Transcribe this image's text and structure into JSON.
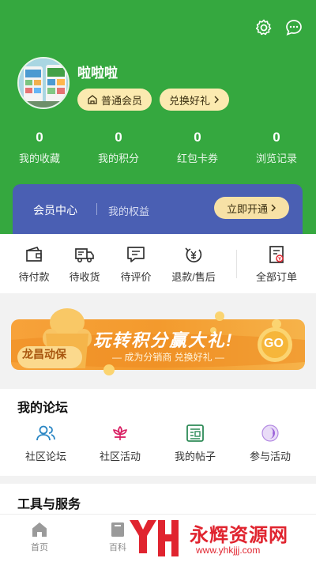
{
  "header": {
    "username": "啦啦啦",
    "member_badge": "普通会员",
    "redeem_label": "兑换好礼",
    "settings_icon": "gear-icon",
    "message_icon": "chat-bubble-icon"
  },
  "stats": [
    {
      "value": "0",
      "label": "我的收藏"
    },
    {
      "value": "0",
      "label": "我的积分"
    },
    {
      "value": "0",
      "label": "红包卡券"
    },
    {
      "value": "0",
      "label": "浏览记录"
    }
  ],
  "member_card": {
    "title": "会员中心",
    "subtitle": "我的权益",
    "button": "立即开通"
  },
  "orders": [
    {
      "label": "待付款",
      "icon": "wallet-icon"
    },
    {
      "label": "待收货",
      "icon": "truck-icon"
    },
    {
      "label": "待评价",
      "icon": "comment-icon"
    },
    {
      "label": "退款/售后",
      "icon": "refund-icon"
    },
    {
      "label": "全部订单",
      "icon": "order-list-icon"
    }
  ],
  "banner": {
    "brand": "龙昌动保",
    "headline": "玩转积分赢大礼!",
    "subline": "— 成为分销商 兑换好礼 —",
    "go": "GO"
  },
  "forum": {
    "title": "我的论坛",
    "items": [
      {
        "label": "社区论坛",
        "icon": "people-icon"
      },
      {
        "label": "社区活动",
        "icon": "flower-icon"
      },
      {
        "label": "我的帖子",
        "icon": "post-icon"
      },
      {
        "label": "参与活动",
        "icon": "moon-icon"
      }
    ]
  },
  "tools": {
    "title": "工具与服务"
  },
  "tabbar": [
    {
      "label": "首页",
      "icon": "home-icon"
    },
    {
      "label": "百科",
      "icon": "book-icon"
    }
  ],
  "watermark": {
    "brand": "永辉资源网",
    "url": "www.yhkjjj.com"
  },
  "colors": {
    "header_green": "#35a83f",
    "member_blue": "#4a5fb3",
    "gold": "#f7e1a6",
    "accent_red": "#e0242f"
  }
}
